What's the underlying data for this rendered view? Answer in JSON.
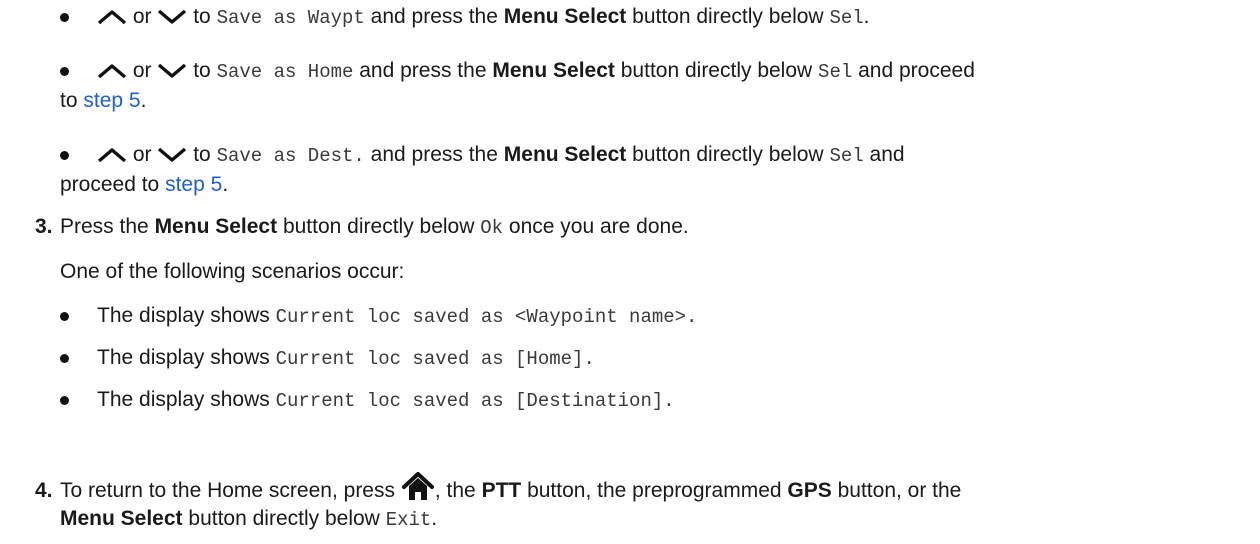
{
  "b1": {
    "or": "or",
    "to": "to",
    "opt": "Save as Waypt",
    "mid": "and press the",
    "btn": "Menu Select",
    "below": "button directly below",
    "sel": "Sel",
    "end": "."
  },
  "b2": {
    "or": "or",
    "to": "to",
    "opt": "Save as Home",
    "mid": "and press the",
    "btn": "Menu Select",
    "below": "button directly below",
    "sel": "Sel",
    "after": "and proceed",
    "to2": "to",
    "link": "step 5",
    "end": "."
  },
  "b3": {
    "or": "or",
    "to": "to",
    "opt": "Save as Dest.",
    "mid": "and press the",
    "btn": "Menu Select",
    "below": "button directly below",
    "sel": "Sel",
    "after": "and",
    "proceed": "proceed to",
    "link": "step 5",
    "end": "."
  },
  "step3": {
    "num": "3.",
    "pre": "Press the",
    "btn": "Menu Select",
    "below": "button directly below",
    "ok": "Ok",
    "post": "once you are done.",
    "intro": "One of the following scenarios occur:",
    "items": [
      {
        "pre": "The display shows",
        "code": "Current loc saved as <Waypoint name>."
      },
      {
        "pre": "The display shows",
        "code": "Current loc saved as [Home]."
      },
      {
        "pre": "The display shows",
        "code": "Current loc saved as [Destination]."
      }
    ]
  },
  "step4": {
    "num": "4.",
    "pre": "To return to the Home screen, press",
    "sep1": ", the",
    "ptt": "PTT",
    "mid": "button, the preprogrammed",
    "gps": "GPS",
    "post": "button, or the",
    "btn": "Menu Select",
    "below": "button directly below",
    "exit": "Exit",
    "end": "."
  }
}
